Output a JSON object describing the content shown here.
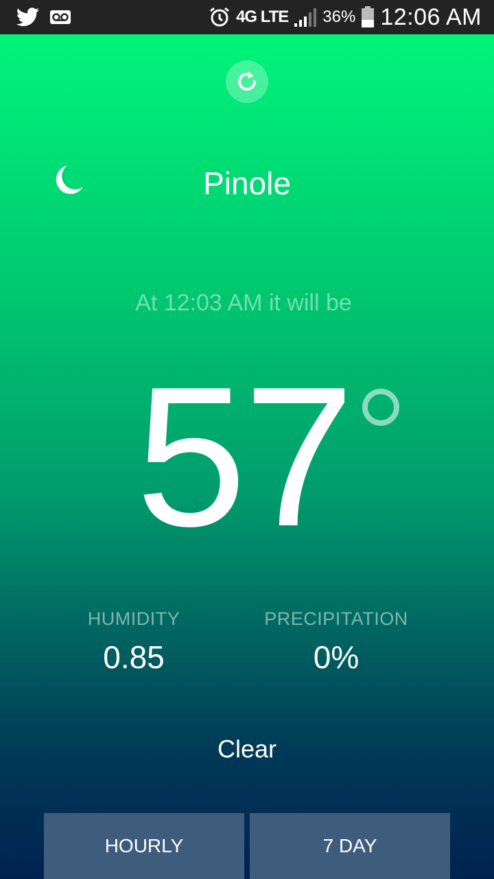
{
  "statusbar": {
    "network": "4G LTE",
    "battery": "36%",
    "clock": "12:06 AM",
    "icons": [
      "twitter-icon",
      "voicemail-icon",
      "alarm-icon",
      "signal-icon",
      "battery-icon"
    ]
  },
  "weather": {
    "location": "Pinole",
    "forecast_time_text": "At 12:03 AM it will be",
    "temperature": "57",
    "humidity_label": "HUMIDITY",
    "humidity_value": "0.85",
    "precip_label": "PRECIPITATION",
    "precip_value": "0%",
    "summary": "Clear",
    "condition_icon": "moon-icon"
  },
  "buttons": {
    "hourly": "HOURLY",
    "seven_day": "7 DAY",
    "refresh_icon": "refresh-icon"
  },
  "colors": {
    "gradient_top": "#00fa7c",
    "gradient_bottom": "#002250",
    "button_bg": "#3e5d7c",
    "statusbar_bg": "#232323"
  }
}
